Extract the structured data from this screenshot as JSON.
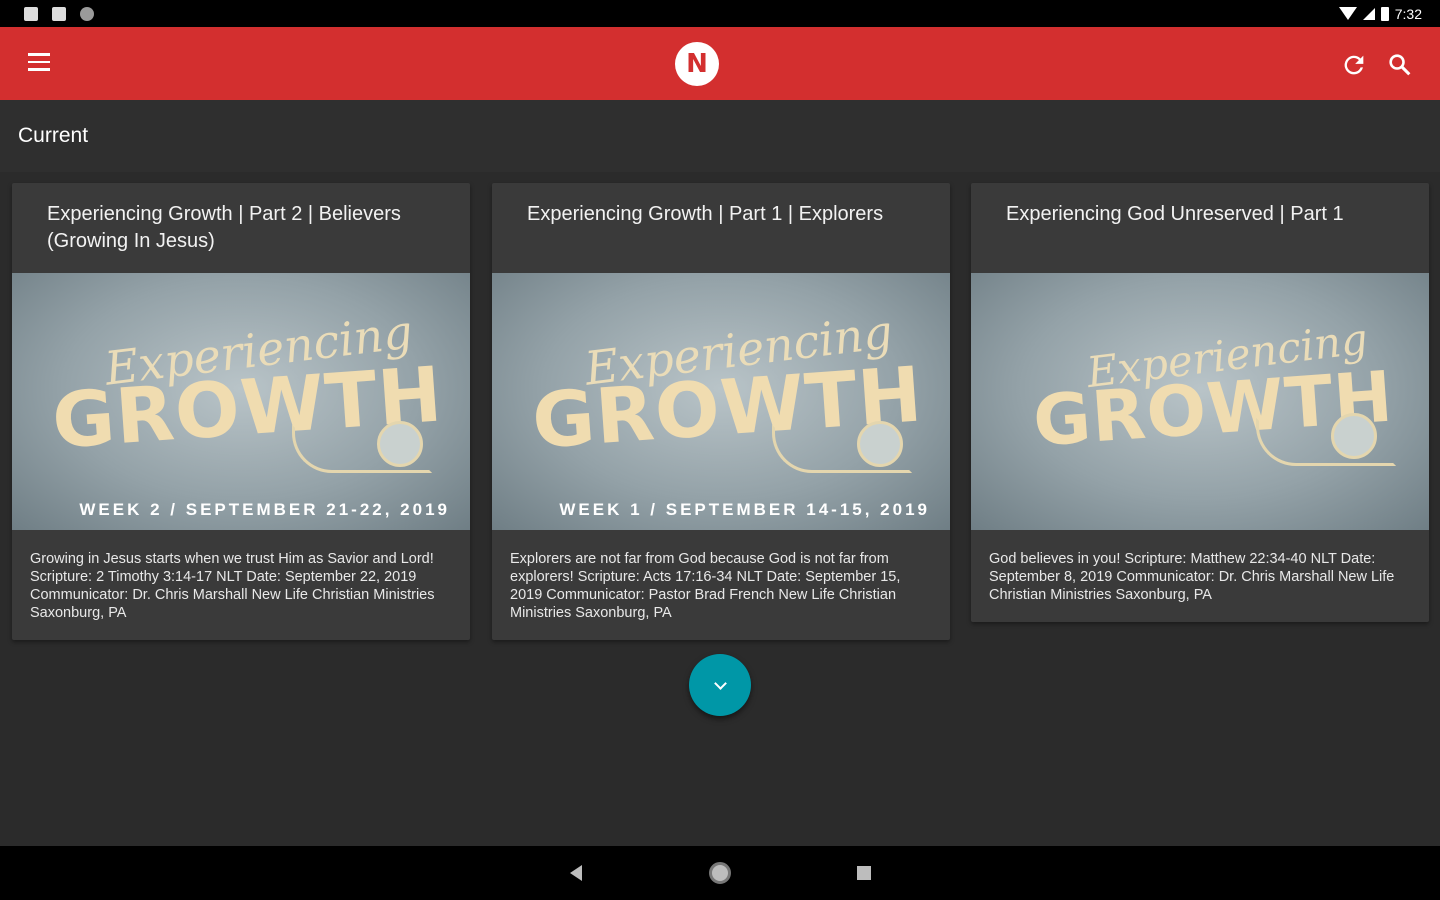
{
  "status_bar": {
    "time": "7:32"
  },
  "app_bar": {
    "menu_icon": "hamburger-menu-icon",
    "logo_letter": "N",
    "refresh_icon": "refresh-icon",
    "search_icon": "search-icon",
    "color": "#d32f2f"
  },
  "section": {
    "title": "Current"
  },
  "cards": [
    {
      "title": "Experiencing Growth | Part 2 | Believers (Growing In Jesus)",
      "image": {
        "script": "Experiencing",
        "big": "GROWTH",
        "footer": "WEEK 2  /  SEPTEMBER 21-22, 2019"
      },
      "description": "Growing in Jesus starts when we trust Him as Savior and Lord! Scripture: 2 Timothy 3:14-17 NLT Date: September 22, 2019 Communicator: Dr. Chris Marshall New Life Christian Ministries Saxonburg, PA"
    },
    {
      "title": "Experiencing Growth | Part 1 | Explorers",
      "image": {
        "script": "Experiencing",
        "big": "GROWTH",
        "footer": "WEEK 1  /  SEPTEMBER 14-15, 2019"
      },
      "description": "Explorers are not far from God because God is not far from explorers! Scripture: Acts 17:16-34 NLT Date: September 15, 2019 Communicator: Pastor Brad French New Life Christian Ministries Saxonburg, PA"
    },
    {
      "title": "Experiencing God Unreserved | Part 1",
      "image": {
        "script": "Experiencing",
        "big": "GROWTH",
        "footer": ""
      },
      "description": "God believes in you! Scripture: Matthew 22:34-40 NLT Date: September 8, 2019 Communicator: Dr. Chris Marshall New Life Christian Ministries Saxonburg, PA"
    }
  ],
  "fab": {
    "icon": "chevron-down-icon",
    "color": "#0097a7"
  },
  "nav_bar": {
    "back_icon": "back-icon",
    "home_icon": "home-icon",
    "recents_icon": "recents-icon"
  }
}
